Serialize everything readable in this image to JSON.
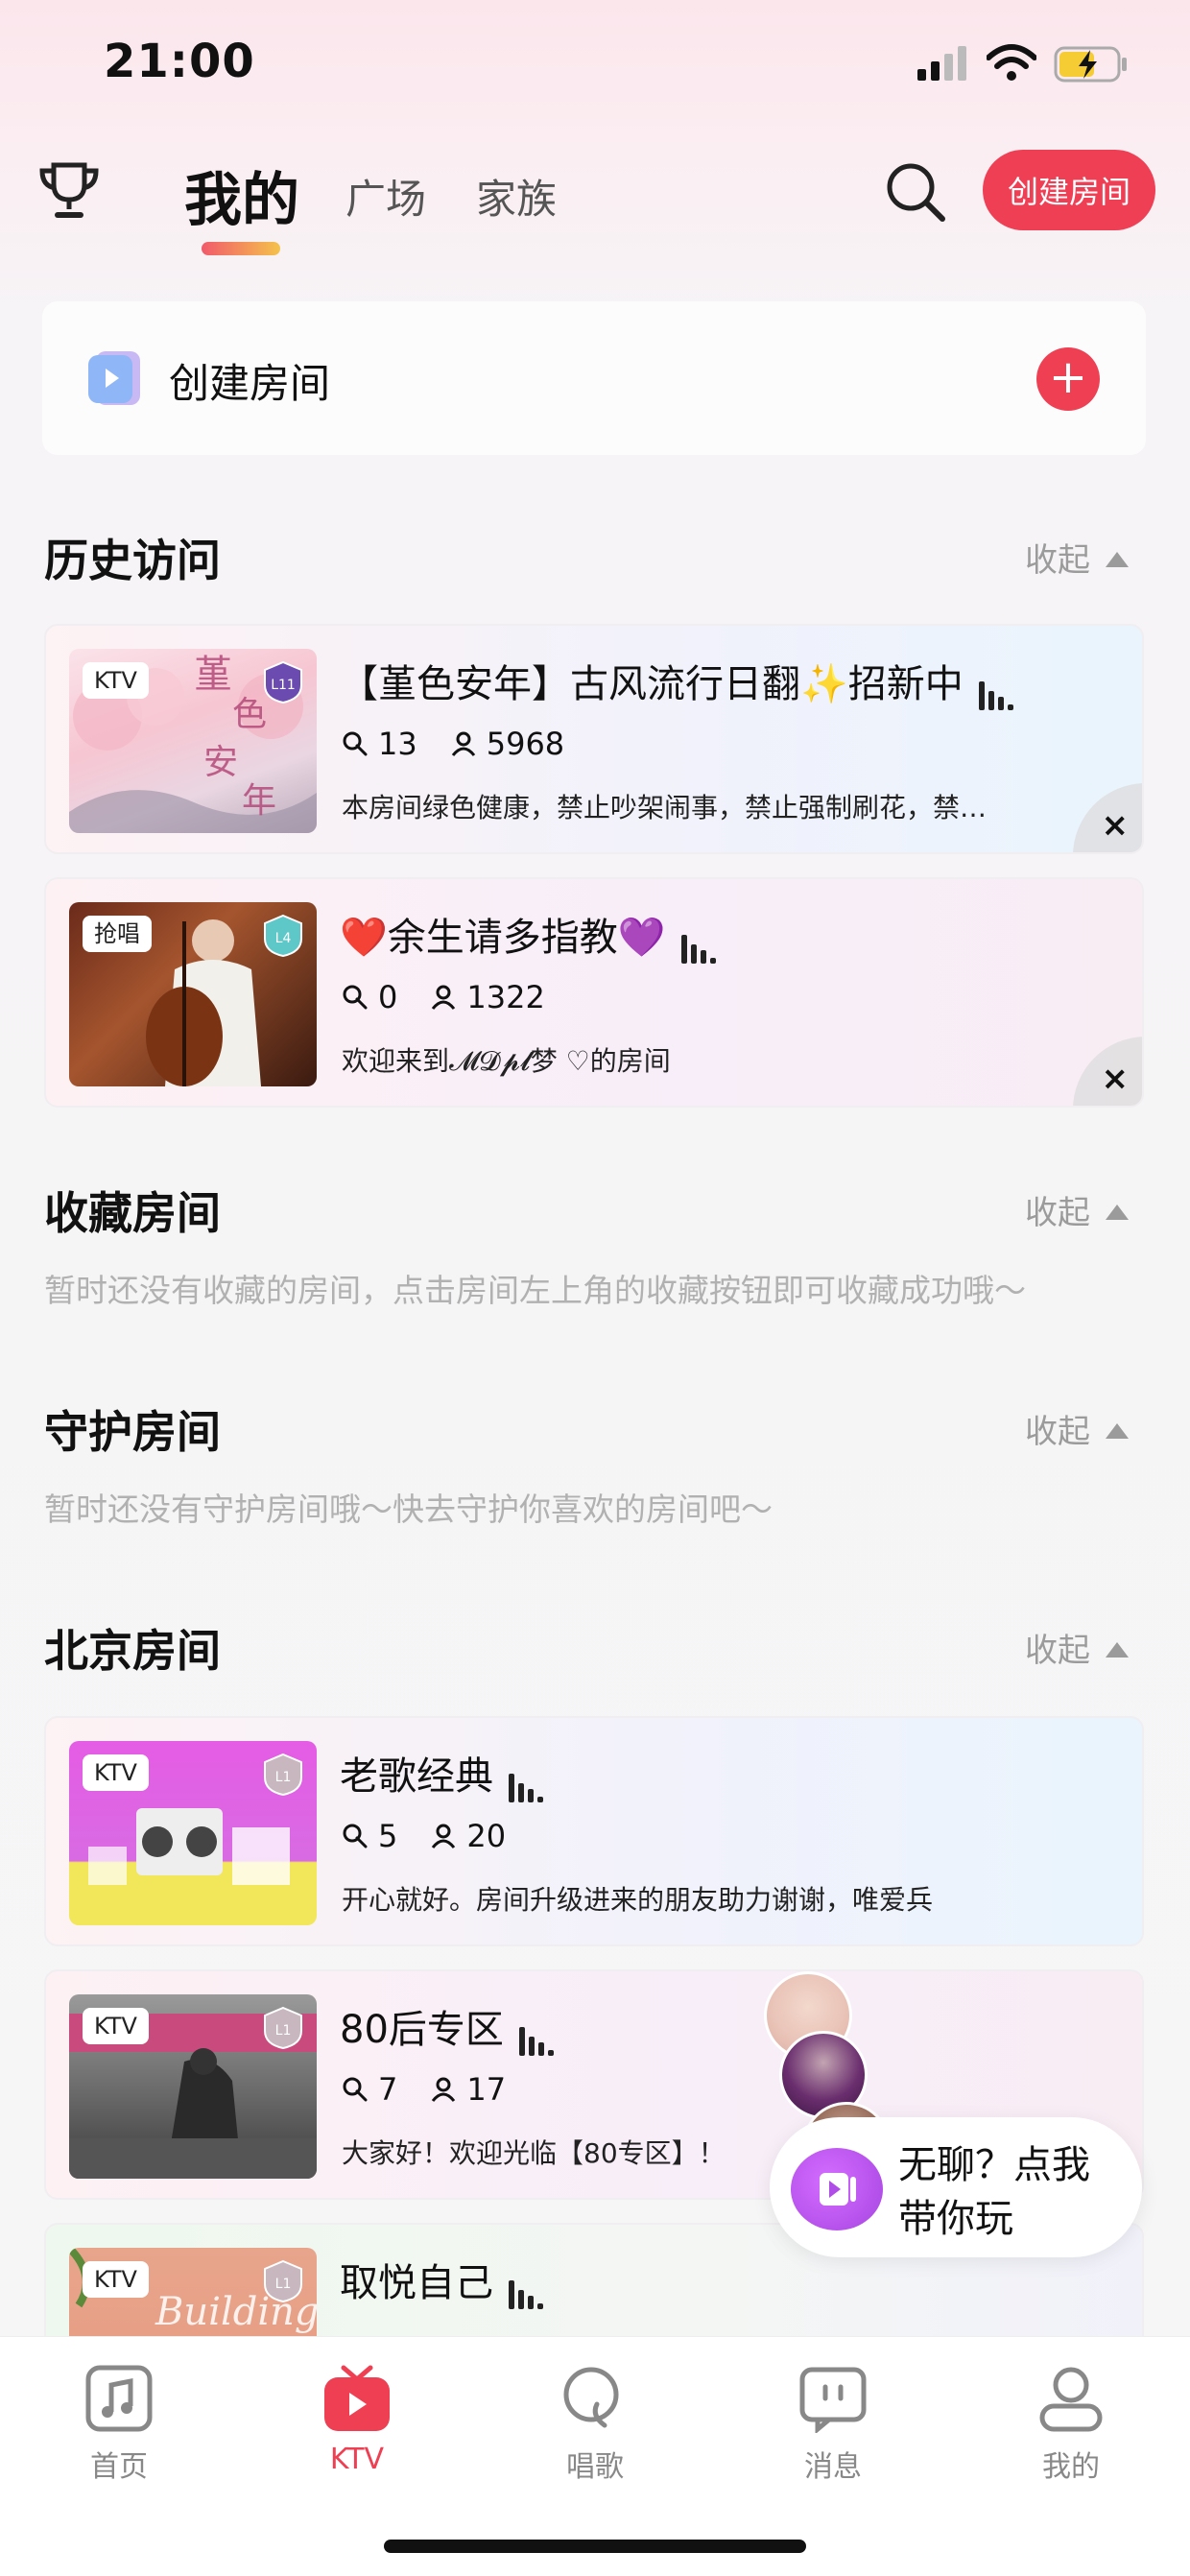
{
  "status_bar": {
    "time": "21:00"
  },
  "header": {
    "tabs": [
      {
        "label": "我的",
        "active": true
      },
      {
        "label": "广场",
        "active": false
      },
      {
        "label": "家族",
        "active": false
      }
    ],
    "create_button": "创建房间"
  },
  "create_card": {
    "label": "创建房间",
    "plus": "+"
  },
  "sections": {
    "history": {
      "title": "历史访问",
      "collapse": "收起"
    },
    "favorites": {
      "title": "收藏房间",
      "collapse": "收起",
      "empty": "暂时还没有收藏的房间，点击房间左上角的收藏按钮即可收藏成功哦～"
    },
    "guard": {
      "title": "守护房间",
      "collapse": "收起",
      "empty": "暂时还没有守护房间哦～快去守护你喜欢的房间吧～"
    },
    "beijing": {
      "title": "北京房间",
      "collapse": "收起"
    }
  },
  "history_rooms": [
    {
      "badge": "KTV",
      "level": "L11",
      "title": "【堇色安年】古风流行日翻✨招新中",
      "mics": "13",
      "listeners": "5968",
      "desc": "本房间绿色健康，禁止吵架闹事，禁止强制刷花，禁…",
      "remove": "×"
    },
    {
      "badge": "抢唱",
      "level": "L4",
      "title": "❤️余生请多指教💜",
      "mics": "0",
      "listeners": "1322",
      "desc": "欢迎来到𝓜𝓓𝓹𝓵梦 ♡的房间",
      "remove": "×"
    }
  ],
  "beijing_rooms": [
    {
      "badge": "KTV",
      "level": "L1",
      "title": "老歌经典",
      "mics": "5",
      "listeners": "20",
      "desc": "开心就好。房间升级进来的朋友助力谢谢，唯爱兵"
    },
    {
      "badge": "KTV",
      "level": "L1",
      "title": "80后专区",
      "mics": "7",
      "listeners": "17",
      "desc": "大家好！欢迎光临【80专区】！"
    },
    {
      "badge": "KTV",
      "level": "L1",
      "title": "取悦自己",
      "mics": "",
      "listeners": "",
      "desc": ""
    }
  ],
  "helper": {
    "line1": "无聊？点我",
    "line2": "带你玩"
  },
  "bottom_nav": [
    {
      "label": "首页",
      "icon": "music-note-icon",
      "active": false
    },
    {
      "label": "KTV",
      "icon": "ktv-tv-icon",
      "active": true
    },
    {
      "label": "唱歌",
      "icon": "sing-icon",
      "active": false
    },
    {
      "label": "消息",
      "icon": "message-icon",
      "active": false
    },
    {
      "label": "我的",
      "icon": "profile-icon",
      "active": false
    }
  ],
  "colors": {
    "accent": "#ee3f53",
    "muted": "#9b9b9b",
    "helper_purple": "#b04de8"
  }
}
